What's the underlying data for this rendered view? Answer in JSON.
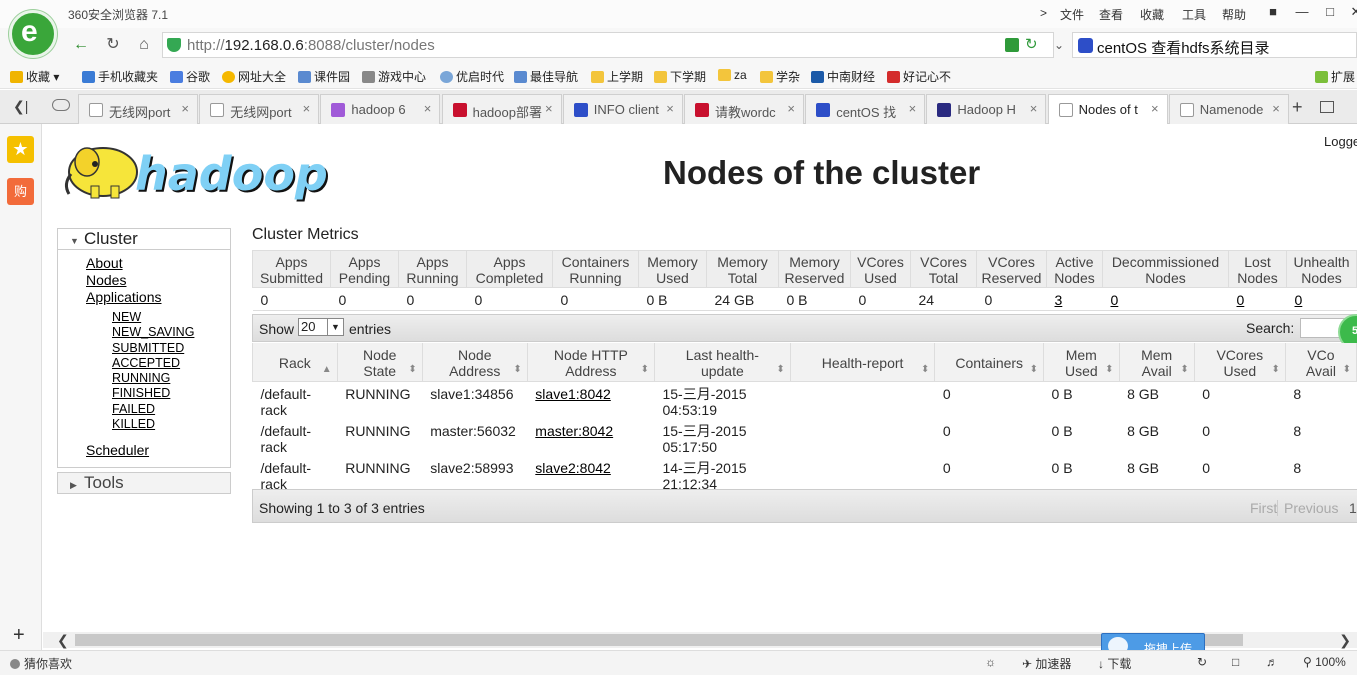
{
  "browser": {
    "app_title": "360安全浏览器 7.1",
    "title_menus": [
      "文件",
      "查看",
      "收藏",
      "工具",
      "帮助"
    ],
    "url_prefix": "http://",
    "url_host": "192.168.0.6",
    "url_rest": ":8088/cluster/nodes",
    "search_text": "centOS 查看hdfs系统目录",
    "favorites": [
      "收藏",
      "手机收藏夹",
      "谷歌",
      "网址大全",
      "课件园",
      "游戏中心",
      "优启时代",
      "最佳导航",
      "上学期",
      "下学期",
      "za",
      "学杂",
      "中南财经",
      "好记心不"
    ],
    "fav_extend": "扩展",
    "tabs": [
      "无线网port",
      "无线网port",
      "hadoop 6",
      "hadoop部署",
      "INFO client",
      "请教wordc",
      "centOS 找",
      "Hadoop H",
      "Nodes of t",
      "Namenode"
    ],
    "active_tab_index": 8,
    "status_left": "猜你喜欢",
    "status_items": [
      "加速器",
      "下载",
      "100%"
    ],
    "upload_label": "拖拽上传"
  },
  "page": {
    "logo_text": "hadoop",
    "title": "Nodes of the cluster",
    "logged_in": "Logge",
    "nav": {
      "cluster_label": "Cluster",
      "links": [
        "About",
        "Nodes",
        "Applications"
      ],
      "app_states": [
        "NEW",
        "NEW_SAVING",
        "SUBMITTED",
        "ACCEPTED",
        "RUNNING",
        "FINISHED",
        "FAILED",
        "KILLED"
      ],
      "scheduler": "Scheduler",
      "tools_label": "Tools"
    },
    "metrics": {
      "title": "Cluster Metrics",
      "headers": [
        [
          "Apps",
          "Submitted"
        ],
        [
          "Apps",
          "Pending"
        ],
        [
          "Apps",
          "Running"
        ],
        [
          "Apps",
          "Completed"
        ],
        [
          "Containers",
          "Running"
        ],
        [
          "Memory",
          "Used"
        ],
        [
          "Memory",
          "Total"
        ],
        [
          "Memory",
          "Reserved"
        ],
        [
          "VCores",
          "Used"
        ],
        [
          "VCores",
          "Total"
        ],
        [
          "VCores",
          "Reserved"
        ],
        [
          "Active",
          "Nodes"
        ],
        [
          "Decommissioned",
          "Nodes"
        ],
        [
          "Lost",
          "Nodes"
        ],
        [
          "Unhealth",
          "Nodes"
        ]
      ],
      "values": [
        "0",
        "0",
        "0",
        "0",
        "0",
        "0 B",
        "24 GB",
        "0 B",
        "0",
        "24",
        "0",
        "3",
        "0",
        "0",
        "0"
      ],
      "linked": [
        false,
        false,
        false,
        false,
        false,
        false,
        false,
        false,
        false,
        false,
        false,
        true,
        true,
        true,
        true
      ]
    },
    "table": {
      "show_label": "Show",
      "page_size": "20",
      "entries_label": "entries",
      "search_label": "Search:",
      "badge": "51",
      "headers": [
        [
          "Rack"
        ],
        [
          "Node",
          "State"
        ],
        [
          "Node",
          "Address"
        ],
        [
          "Node HTTP",
          "Address"
        ],
        [
          "Last health-update"
        ],
        [
          "Health-report"
        ],
        [
          "Containers"
        ],
        [
          "Mem",
          "Used"
        ],
        [
          "Mem",
          "Avail"
        ],
        [
          "VCores",
          "Used"
        ],
        [
          "VCo",
          "Avail"
        ]
      ],
      "rows": [
        [
          "/default-rack",
          "RUNNING",
          "slave1:34856",
          "slave1:8042",
          "15-三月-2015 04:53:19",
          "",
          "0",
          "0 B",
          "8 GB",
          "0",
          "8"
        ],
        [
          "/default-rack",
          "RUNNING",
          "master:56032",
          "master:8042",
          "15-三月-2015 05:17:50",
          "",
          "0",
          "0 B",
          "8 GB",
          "0",
          "8"
        ],
        [
          "/default-rack",
          "RUNNING",
          "slave2:58993",
          "slave2:8042",
          "14-三月-2015 21:12:34",
          "",
          "0",
          "0 B",
          "8 GB",
          "0",
          "8"
        ]
      ],
      "info": "Showing 1 to 3 of 3 entries",
      "pager": [
        "First",
        "Previous",
        "1"
      ]
    }
  }
}
